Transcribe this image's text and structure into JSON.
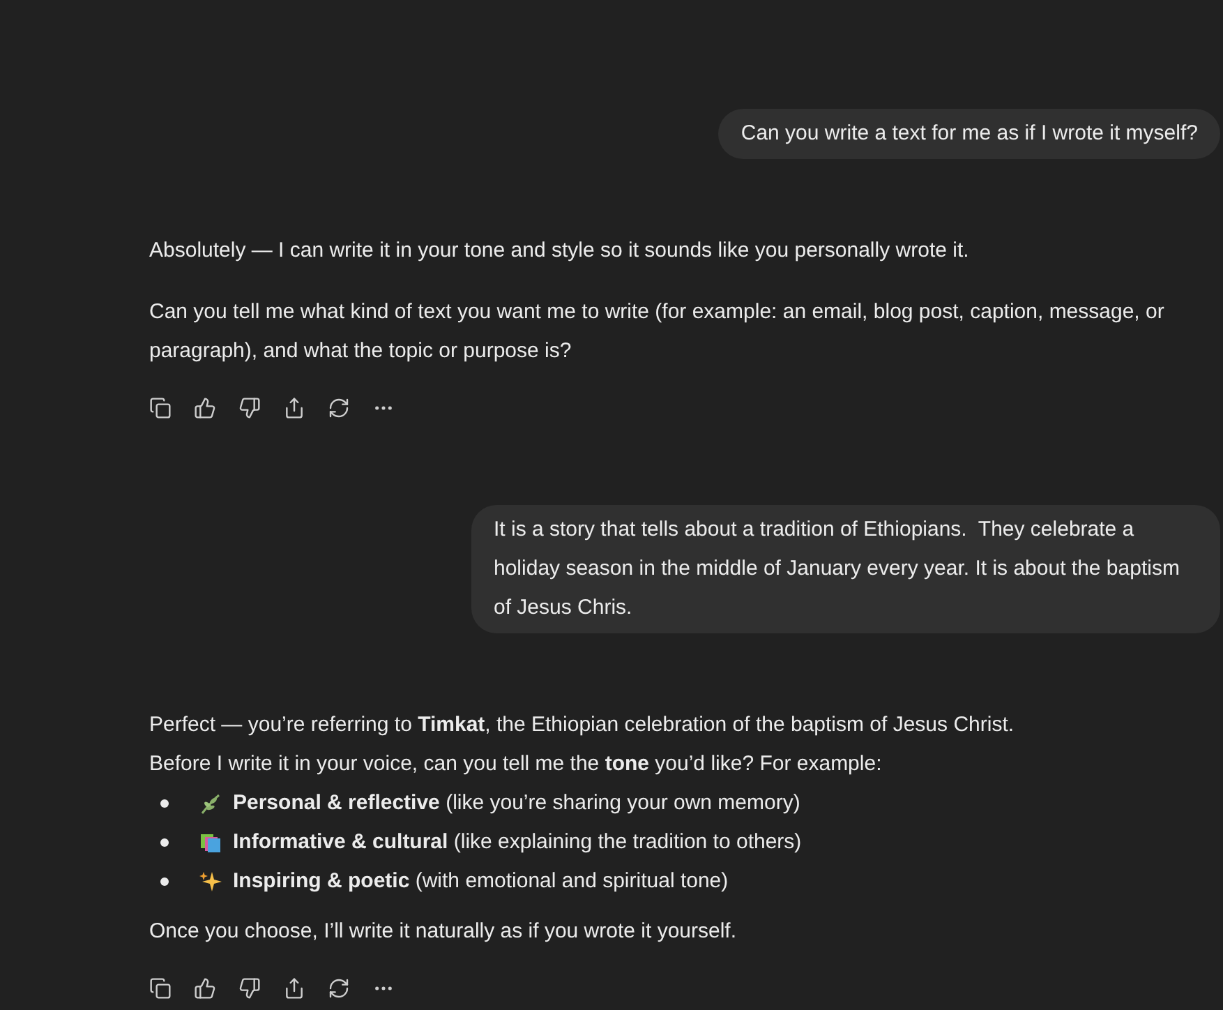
{
  "messages": [
    {
      "kind": "user",
      "text": "Can you write a text for me as if I wrote it myself?"
    },
    {
      "kind": "assistant",
      "paragraphs": [
        "Absolutely — I can write it in your tone and style so it sounds like you personally wrote it.",
        "Can you tell me what kind of text you want me to write (for example: an email, blog post, caption, message, or paragraph), and what the topic or purpose is?"
      ]
    },
    {
      "kind": "user",
      "text": "It is a story that tells about a tradition of Ethiopians.  They celebrate a holiday season in the middle of January every year. It is about the baptism of Jesus Chris."
    },
    {
      "kind": "assistant",
      "paragraphs": [
        "Perfect — you’re referring to **Timkat**, the Ethiopian celebration of the baptism of Jesus Christ.\nBefore I write it in your voice, can you tell me the **tone** you’d like? For example:"
      ],
      "bullets": [
        {
          "kind": "leaf",
          "text": "**Personal & reflective** (like you’re sharing your own memory)"
        },
        {
          "kind": "books",
          "text": "**Informative & cultural** (like explaining the tradition to others)"
        },
        {
          "kind": "sparkles",
          "text": "**Inspiring & poetic** (with emotional and spiritual tone)"
        }
      ],
      "closing": "Once you choose, I’ll write it naturally as if you wrote it yourself."
    }
  ]
}
